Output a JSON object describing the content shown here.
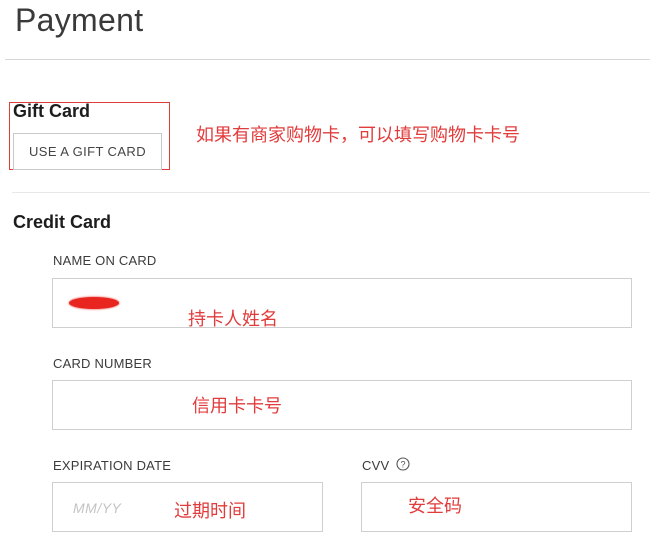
{
  "page": {
    "title": "Payment"
  },
  "gift_card": {
    "title": "Gift Card",
    "button_label": "USE A GIFT CARD",
    "annotation": "如果有商家购物卡，可以填写购物卡卡号"
  },
  "credit_card": {
    "title": "Credit Card",
    "name_on_card": {
      "label": "NAME ON CARD",
      "value": "",
      "annotation": "持卡人姓名"
    },
    "card_number": {
      "label": "CARD NUMBER",
      "value": "",
      "annotation": "信用卡卡号"
    },
    "expiration_date": {
      "label": "EXPIRATION DATE",
      "placeholder": "MM/YY",
      "annotation": "过期时间"
    },
    "cvv": {
      "label": "CVV",
      "help_icon": "question-circle-icon",
      "annotation": "安全码"
    }
  },
  "colors": {
    "annotation": "#e23b3b",
    "redaction": "#e8261f",
    "border": "#cfcfcf"
  }
}
